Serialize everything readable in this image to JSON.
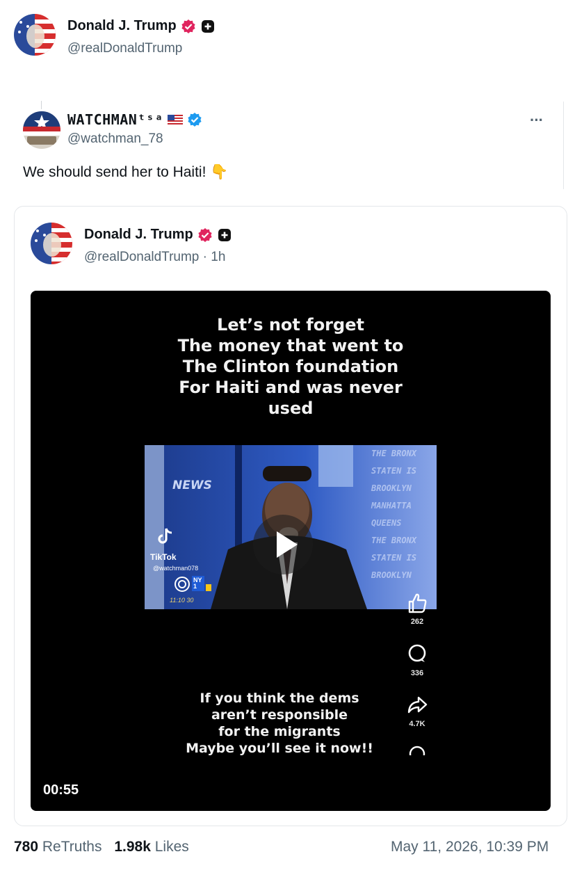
{
  "post": {
    "author_name": "Donald J. Trump",
    "author_handle": "@realDonaldTrump"
  },
  "reply": {
    "author_name": "WATCHMANᵗˢᵃ",
    "author_handle": "@watchman_78",
    "text": "We should send her to Haiti!",
    "text_emoji": "👇",
    "more_label": "···"
  },
  "quoted": {
    "author_name": "Donald J. Trump",
    "author_handle": "@realDonaldTrump",
    "time": "· 1h",
    "video": {
      "top_caption": [
        "Let’s not forget",
        "The money that went to",
        "The Clinton foundation",
        "For Haiti and was never",
        "used"
      ],
      "bottom_caption": [
        "If you think the dems",
        "aren’t responsible",
        "for the migrants",
        "Maybe you’ll see it now!!"
      ],
      "duration": "00:55",
      "tiktok_label": "TikTok",
      "tiktok_user": "@watchman078",
      "news_logo": "NEWS",
      "channel_logo": "NY 1",
      "clock": "11:10 30",
      "boroughs": [
        "THE BRONX",
        "STATEN IS",
        "BROOKLYN",
        "MANHATTA",
        "QUEENS",
        "THE BRONX",
        "STATEN IS",
        "BROOKLYN"
      ],
      "like_count": "262",
      "comment_count": "336",
      "share_count": "4.7K"
    }
  },
  "stats": {
    "retruths_count": "780",
    "retruths_label": "ReTruths",
    "likes_count": "1.98k",
    "likes_label": "Likes",
    "timestamp": "May 11, 2026, 10:39 PM"
  },
  "colors": {
    "verified_red": "#e0245e",
    "verified_blue": "#1d9bf0",
    "text_primary": "#0f1419",
    "text_secondary": "#536471"
  },
  "icons": {
    "verified_badge": "verified-badge-icon",
    "plus_badge": "plus-badge-icon",
    "play": "play-icon",
    "like": "thumbs-up-icon",
    "comment": "comment-bubble-icon",
    "share": "share-arrow-icon"
  }
}
